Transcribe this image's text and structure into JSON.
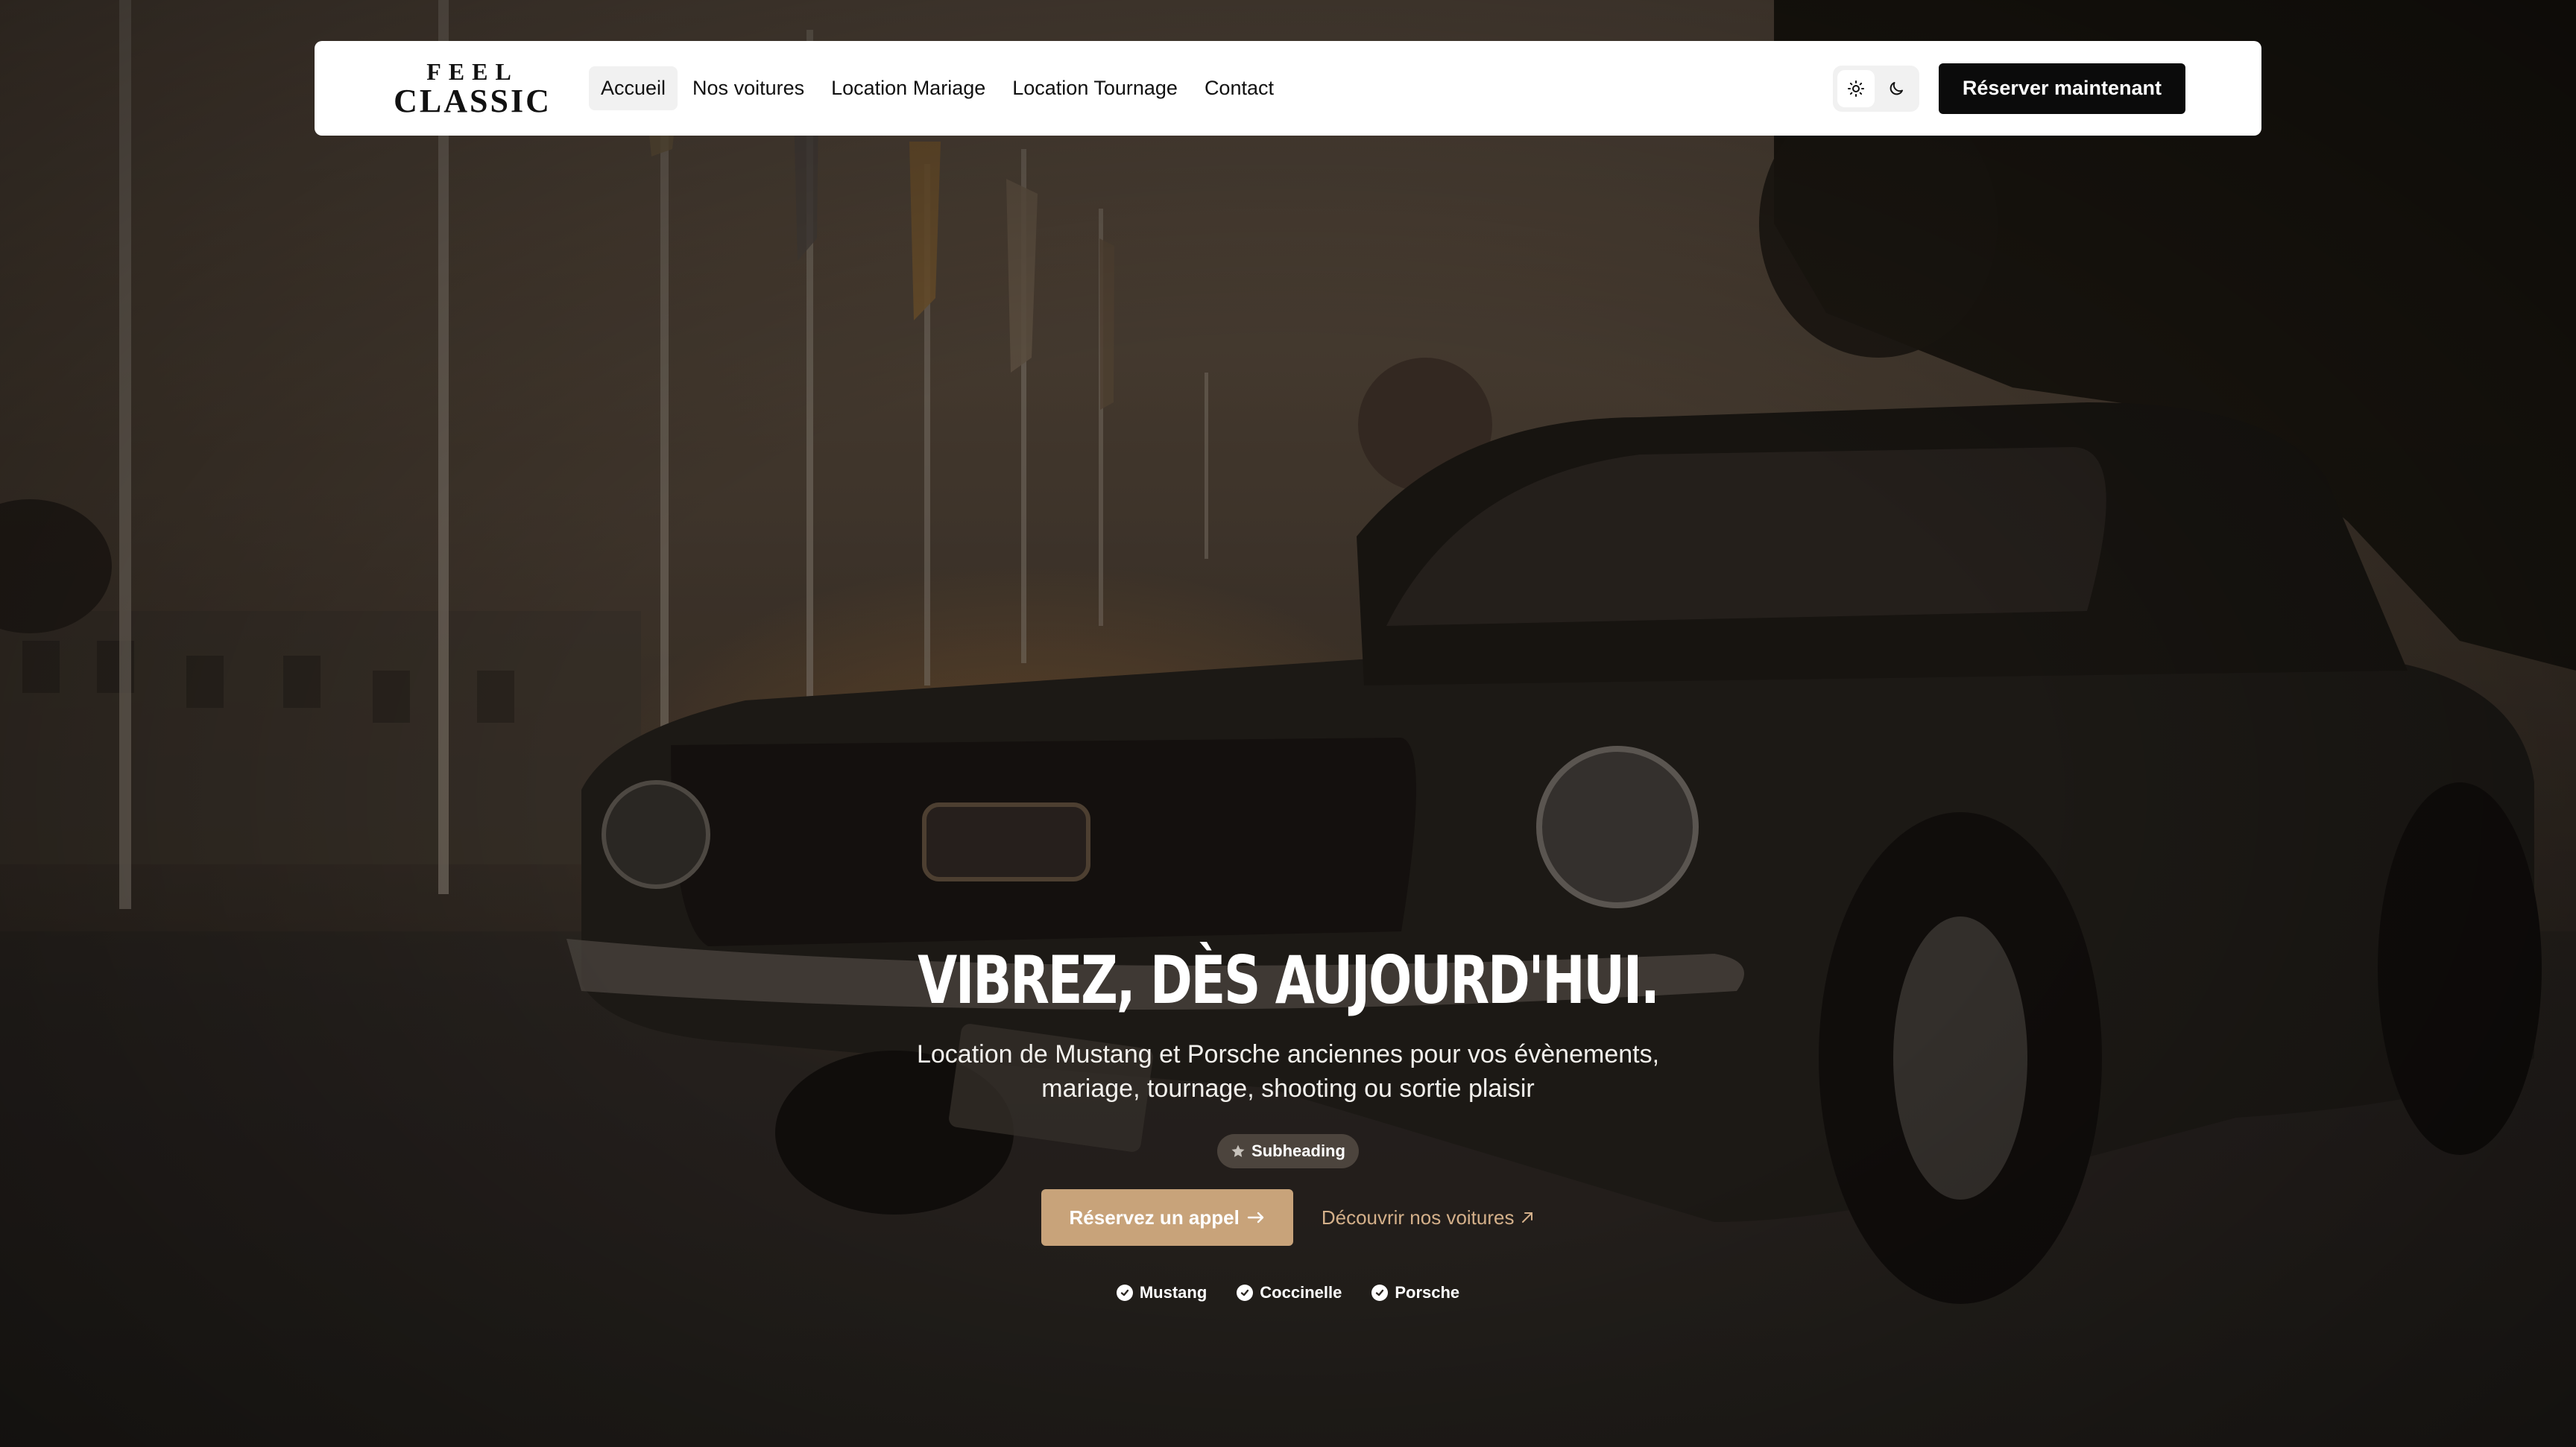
{
  "brand": {
    "logo_line1": "FEEL",
    "logo_line2": "CLASSIC"
  },
  "nav": {
    "items": [
      {
        "label": "Accueil",
        "active": true
      },
      {
        "label": "Nos voitures",
        "active": false
      },
      {
        "label": "Location Mariage",
        "active": false
      },
      {
        "label": "Location Tournage",
        "active": false
      },
      {
        "label": "Contact",
        "active": false
      }
    ],
    "theme_light_icon": "sun-icon",
    "theme_dark_icon": "moon-icon",
    "cta_label": "Réserver maintenant"
  },
  "hero": {
    "title": "VIBREZ, DÈS AUJOURD'HUI.",
    "subtitle": "Location de Mustang et Porsche anciennes pour vos évènements, mariage, tournage, shooting ou sortie plaisir",
    "pill_label": "Subheading",
    "primary_cta": "Réservez un appel",
    "secondary_cta": "Découvrir nos voitures",
    "badges": [
      "Mustang",
      "Coccinelle",
      "Porsche"
    ]
  },
  "colors": {
    "accent": "#c8a37a",
    "accent_text": "#d4b08a",
    "nav_cta_bg": "#0b0b0b",
    "navbar_bg": "#ffffff"
  }
}
